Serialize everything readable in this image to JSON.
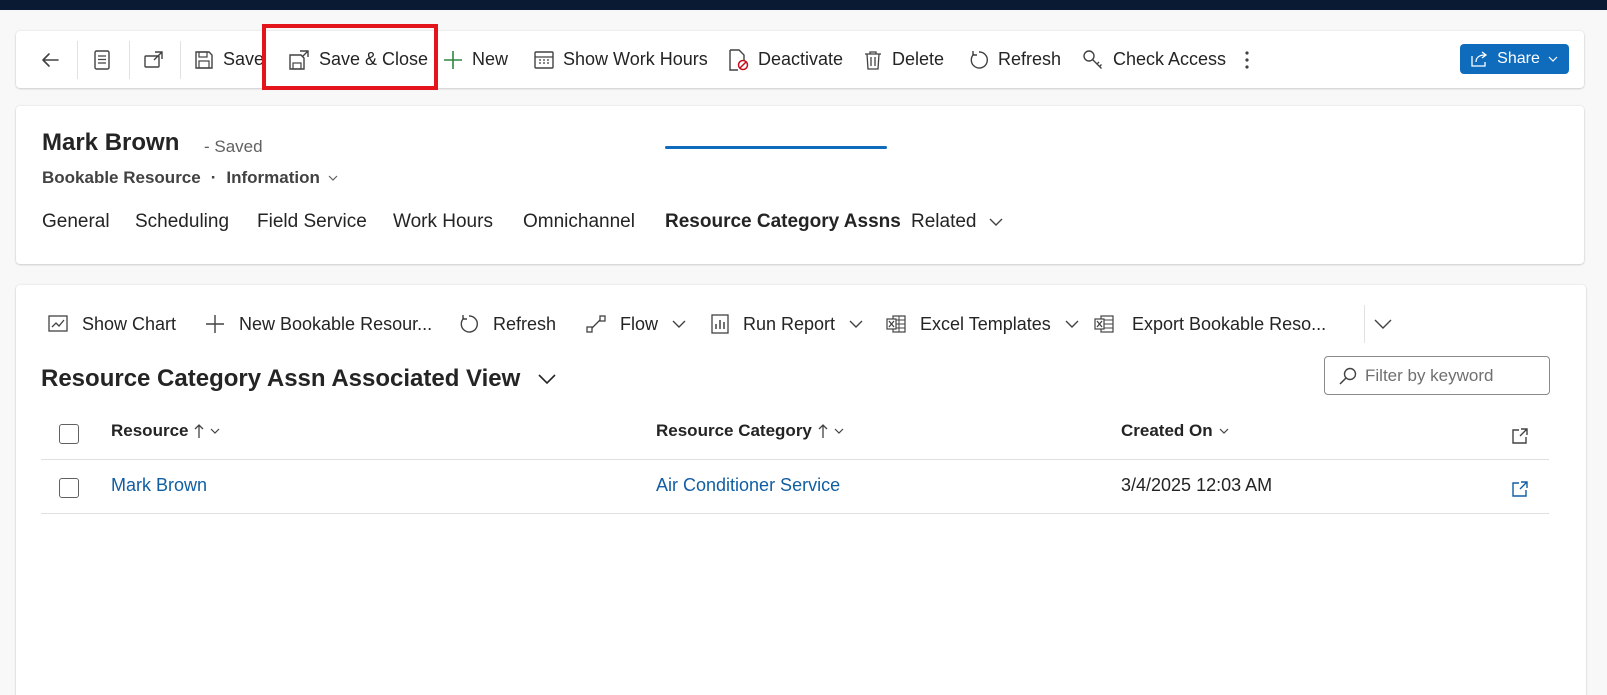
{
  "command_bar": {
    "save_label": "Save",
    "save_close_label": "Save & Close",
    "new_label": "New",
    "show_work_hours_label": "Show Work Hours",
    "deactivate_label": "Deactivate",
    "delete_label": "Delete",
    "refresh_label": "Refresh",
    "check_access_label": "Check Access",
    "share_label": "Share"
  },
  "record": {
    "name": "Mark Brown",
    "status": "- Saved",
    "entity": "Bookable Resource",
    "separator": "·",
    "form": "Information"
  },
  "tabs": [
    {
      "label": "General"
    },
    {
      "label": "Scheduling"
    },
    {
      "label": "Field Service"
    },
    {
      "label": "Work Hours"
    },
    {
      "label": "Omnichannel"
    },
    {
      "label": "Resource Category Assns"
    },
    {
      "label": "Related"
    }
  ],
  "active_tab": "Resource Category Assns",
  "subgrid": {
    "commands": {
      "show_chart": "Show Chart",
      "new_record": "New Bookable Resour...",
      "refresh": "Refresh",
      "flow": "Flow",
      "run_report": "Run Report",
      "excel_templates": "Excel Templates",
      "export": "Export Bookable Reso..."
    },
    "view_title": "Resource Category Assn Associated View",
    "filter_placeholder": "Filter by keyword",
    "columns": [
      {
        "label": "Resource",
        "sort": "ascending"
      },
      {
        "label": "Resource Category",
        "sort": "ascending"
      },
      {
        "label": "Created On",
        "sort": "none"
      }
    ],
    "rows": [
      {
        "resource": "Mark Brown",
        "resource_category": "Air Conditioner Service",
        "created_on": "3/4/2025 12:03 AM"
      }
    ]
  },
  "colors": {
    "top_bar": "#0b1a33",
    "accent": "#0f6cbd",
    "link": "#115ea3",
    "highlight_box": "#e4141b"
  },
  "icons": [
    "back-arrow-icon",
    "form-icon",
    "pop-out-icon",
    "save-icon",
    "save-close-icon",
    "plus-icon",
    "calendar-icon",
    "deactivate-icon",
    "trash-icon",
    "refresh-icon",
    "key-icon",
    "more-vertical-icon",
    "share-icon",
    "chart-icon",
    "flow-icon",
    "report-icon",
    "excel-icon",
    "search-icon",
    "open-record-icon"
  ]
}
